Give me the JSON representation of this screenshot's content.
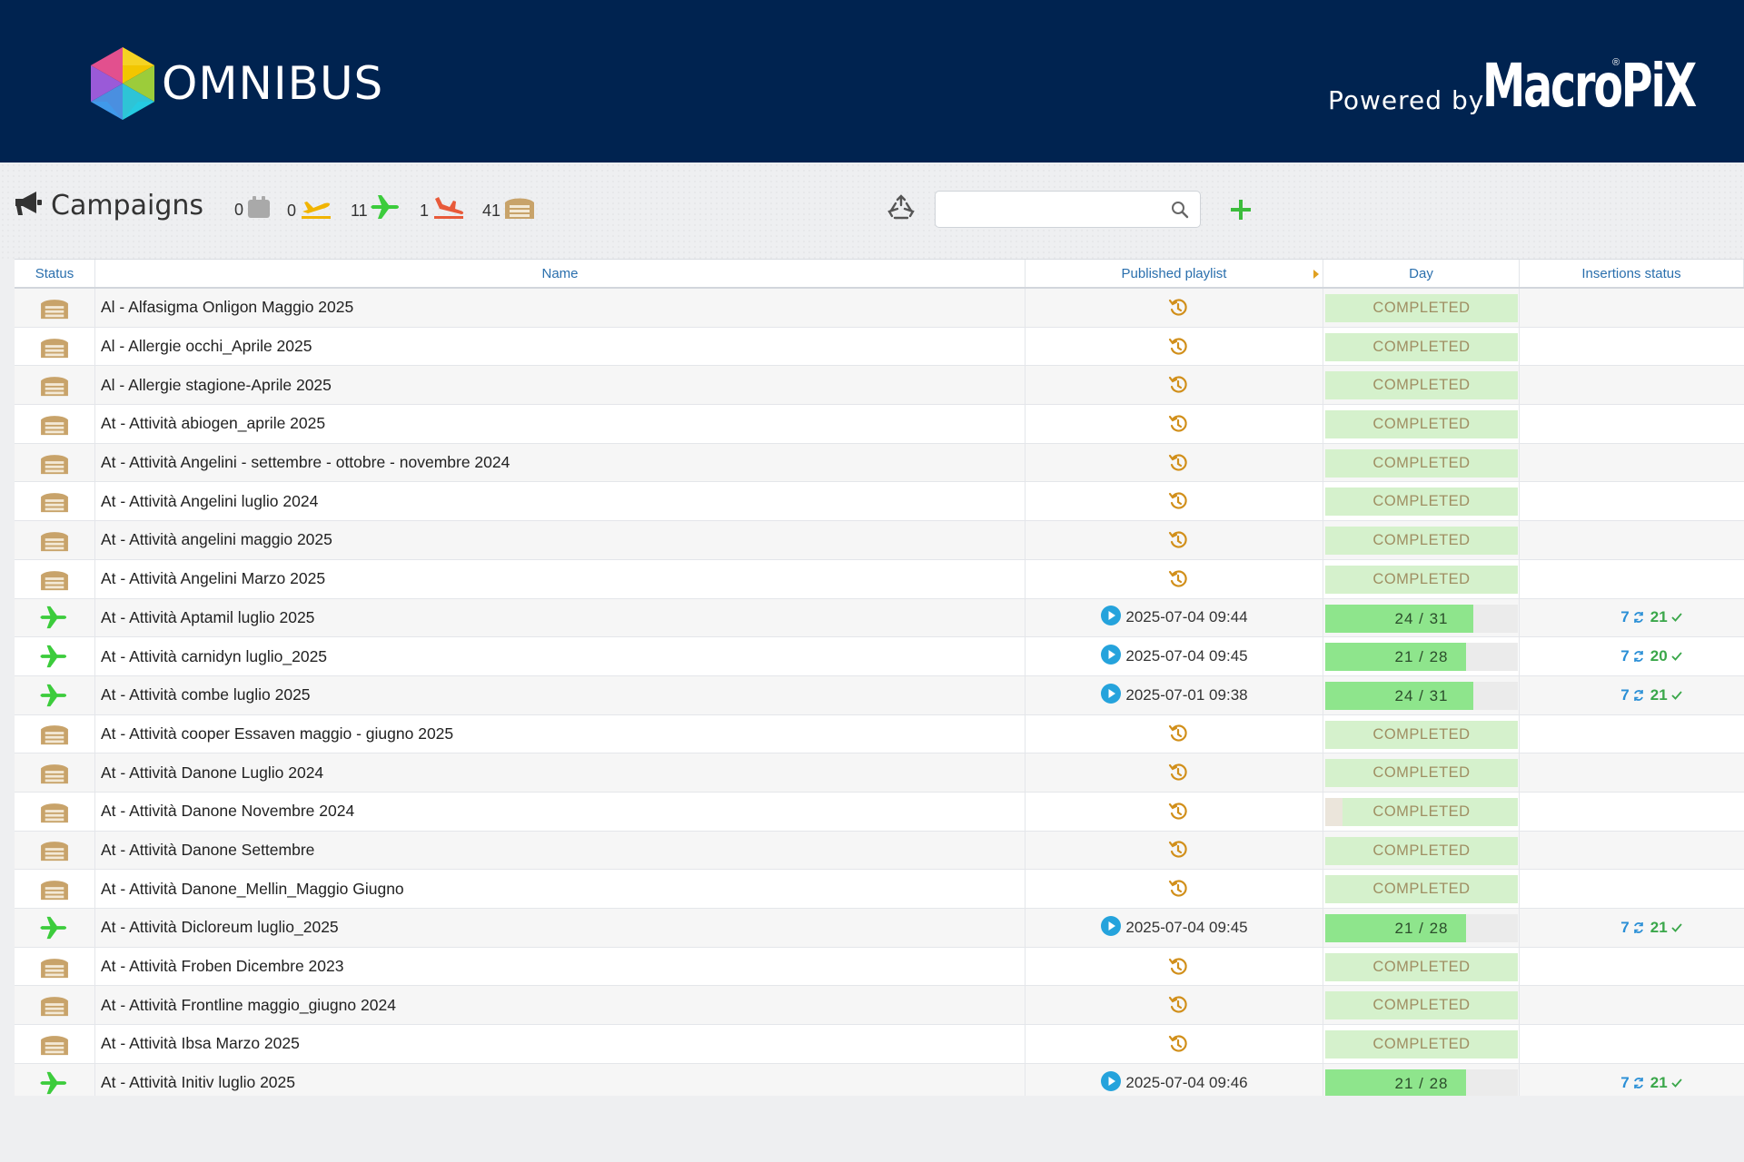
{
  "header": {
    "logo_text": "OMNIBUS",
    "powered_by": "Powered by",
    "brand": "MacroPiX",
    "brand_mark": "®"
  },
  "toolbar": {
    "title": "Campaigns",
    "counters": [
      {
        "value": "0",
        "icon": "calendar-box-icon",
        "color": "#a9a9a9"
      },
      {
        "value": "0",
        "icon": "plane-takeoff-icon",
        "color": "#f1b400"
      },
      {
        "value": "11",
        "icon": "plane-flying-icon",
        "color": "#3ccc3c"
      },
      {
        "value": "1",
        "icon": "plane-landing-icon",
        "color": "#e85a3a"
      },
      {
        "value": "41",
        "icon": "hangar-icon",
        "color": "#c8a36a"
      }
    ],
    "search_value": "",
    "search_placeholder": ""
  },
  "table": {
    "headers": {
      "status": "Status",
      "name": "Name",
      "playlist": "Published playlist",
      "day": "Day",
      "insertions": "Insertions status"
    },
    "rows": [
      {
        "status": "archived",
        "name": "Al - Alfasigma Onligon Maggio 2025",
        "playlist": "",
        "day": "COMPLETED"
      },
      {
        "status": "archived",
        "name": "Al - Allergie occhi_Aprile 2025",
        "playlist": "",
        "day": "COMPLETED"
      },
      {
        "status": "archived",
        "name": "Al - Allergie stagione-Aprile 2025",
        "playlist": "",
        "day": "COMPLETED"
      },
      {
        "status": "archived",
        "name": "At - Attività abiogen_aprile 2025",
        "playlist": "",
        "day": "COMPLETED"
      },
      {
        "status": "archived",
        "name": "At - Attività Angelini - settembre - ottobre - novembre 2024",
        "playlist": "",
        "day": "COMPLETED"
      },
      {
        "status": "archived",
        "name": "At - Attività Angelini luglio 2024",
        "playlist": "",
        "day": "COMPLETED"
      },
      {
        "status": "archived",
        "name": "At - Attività angelini maggio 2025",
        "playlist": "",
        "day": "COMPLETED"
      },
      {
        "status": "archived",
        "name": "At - Attività Angelini Marzo 2025",
        "playlist": "",
        "day": "COMPLETED"
      },
      {
        "status": "flying",
        "name": "At - Attività Aptamil luglio 2025",
        "playlist": "2025-07-04 09:44",
        "day": "24 / 31",
        "progress": 0.77,
        "ins_a": "7",
        "ins_b": "21"
      },
      {
        "status": "flying",
        "name": "At - Attività carnidyn luglio_2025",
        "playlist": "2025-07-04 09:45",
        "day": "21 / 28",
        "progress": 0.73,
        "ins_a": "7",
        "ins_b": "20"
      },
      {
        "status": "flying",
        "name": "At - Attività combe luglio 2025",
        "playlist": "2025-07-01 09:38",
        "day": "24 / 31",
        "progress": 0.77,
        "ins_a": "7",
        "ins_b": "21"
      },
      {
        "status": "archived",
        "name": "At - Attività cooper Essaven maggio - giugno 2025",
        "playlist": "",
        "day": "COMPLETED"
      },
      {
        "status": "archived",
        "name": "At - Attività Danone Luglio 2024",
        "playlist": "",
        "day": "COMPLETED"
      },
      {
        "status": "archived",
        "name": "At - Attività Danone Novembre 2024",
        "playlist": "",
        "day": "COMPLETED",
        "partial": 0.09
      },
      {
        "status": "archived",
        "name": "At - Attività Danone Settembre",
        "playlist": "",
        "day": "COMPLETED"
      },
      {
        "status": "archived",
        "name": "At - Attività Danone_Mellin_Maggio Giugno",
        "playlist": "",
        "day": "COMPLETED"
      },
      {
        "status": "flying",
        "name": "At - Attività Dicloreum luglio_2025",
        "playlist": "2025-07-04 09:45",
        "day": "21 / 28",
        "progress": 0.73,
        "ins_a": "7",
        "ins_b": "21"
      },
      {
        "status": "archived",
        "name": "At - Attività Froben Dicembre 2023",
        "playlist": "",
        "day": "COMPLETED"
      },
      {
        "status": "archived",
        "name": "At - Attività Frontline maggio_giugno 2024",
        "playlist": "",
        "day": "COMPLETED"
      },
      {
        "status": "archived",
        "name": "At - Attività Ibsa Marzo 2025",
        "playlist": "",
        "day": "COMPLETED"
      },
      {
        "status": "flying",
        "name": "At - Attività Initiv luglio 2025",
        "playlist": "2025-07-04 09:46",
        "day": "21 / 28",
        "progress": 0.73,
        "ins_a": "7",
        "ins_b": "21"
      }
    ]
  }
}
